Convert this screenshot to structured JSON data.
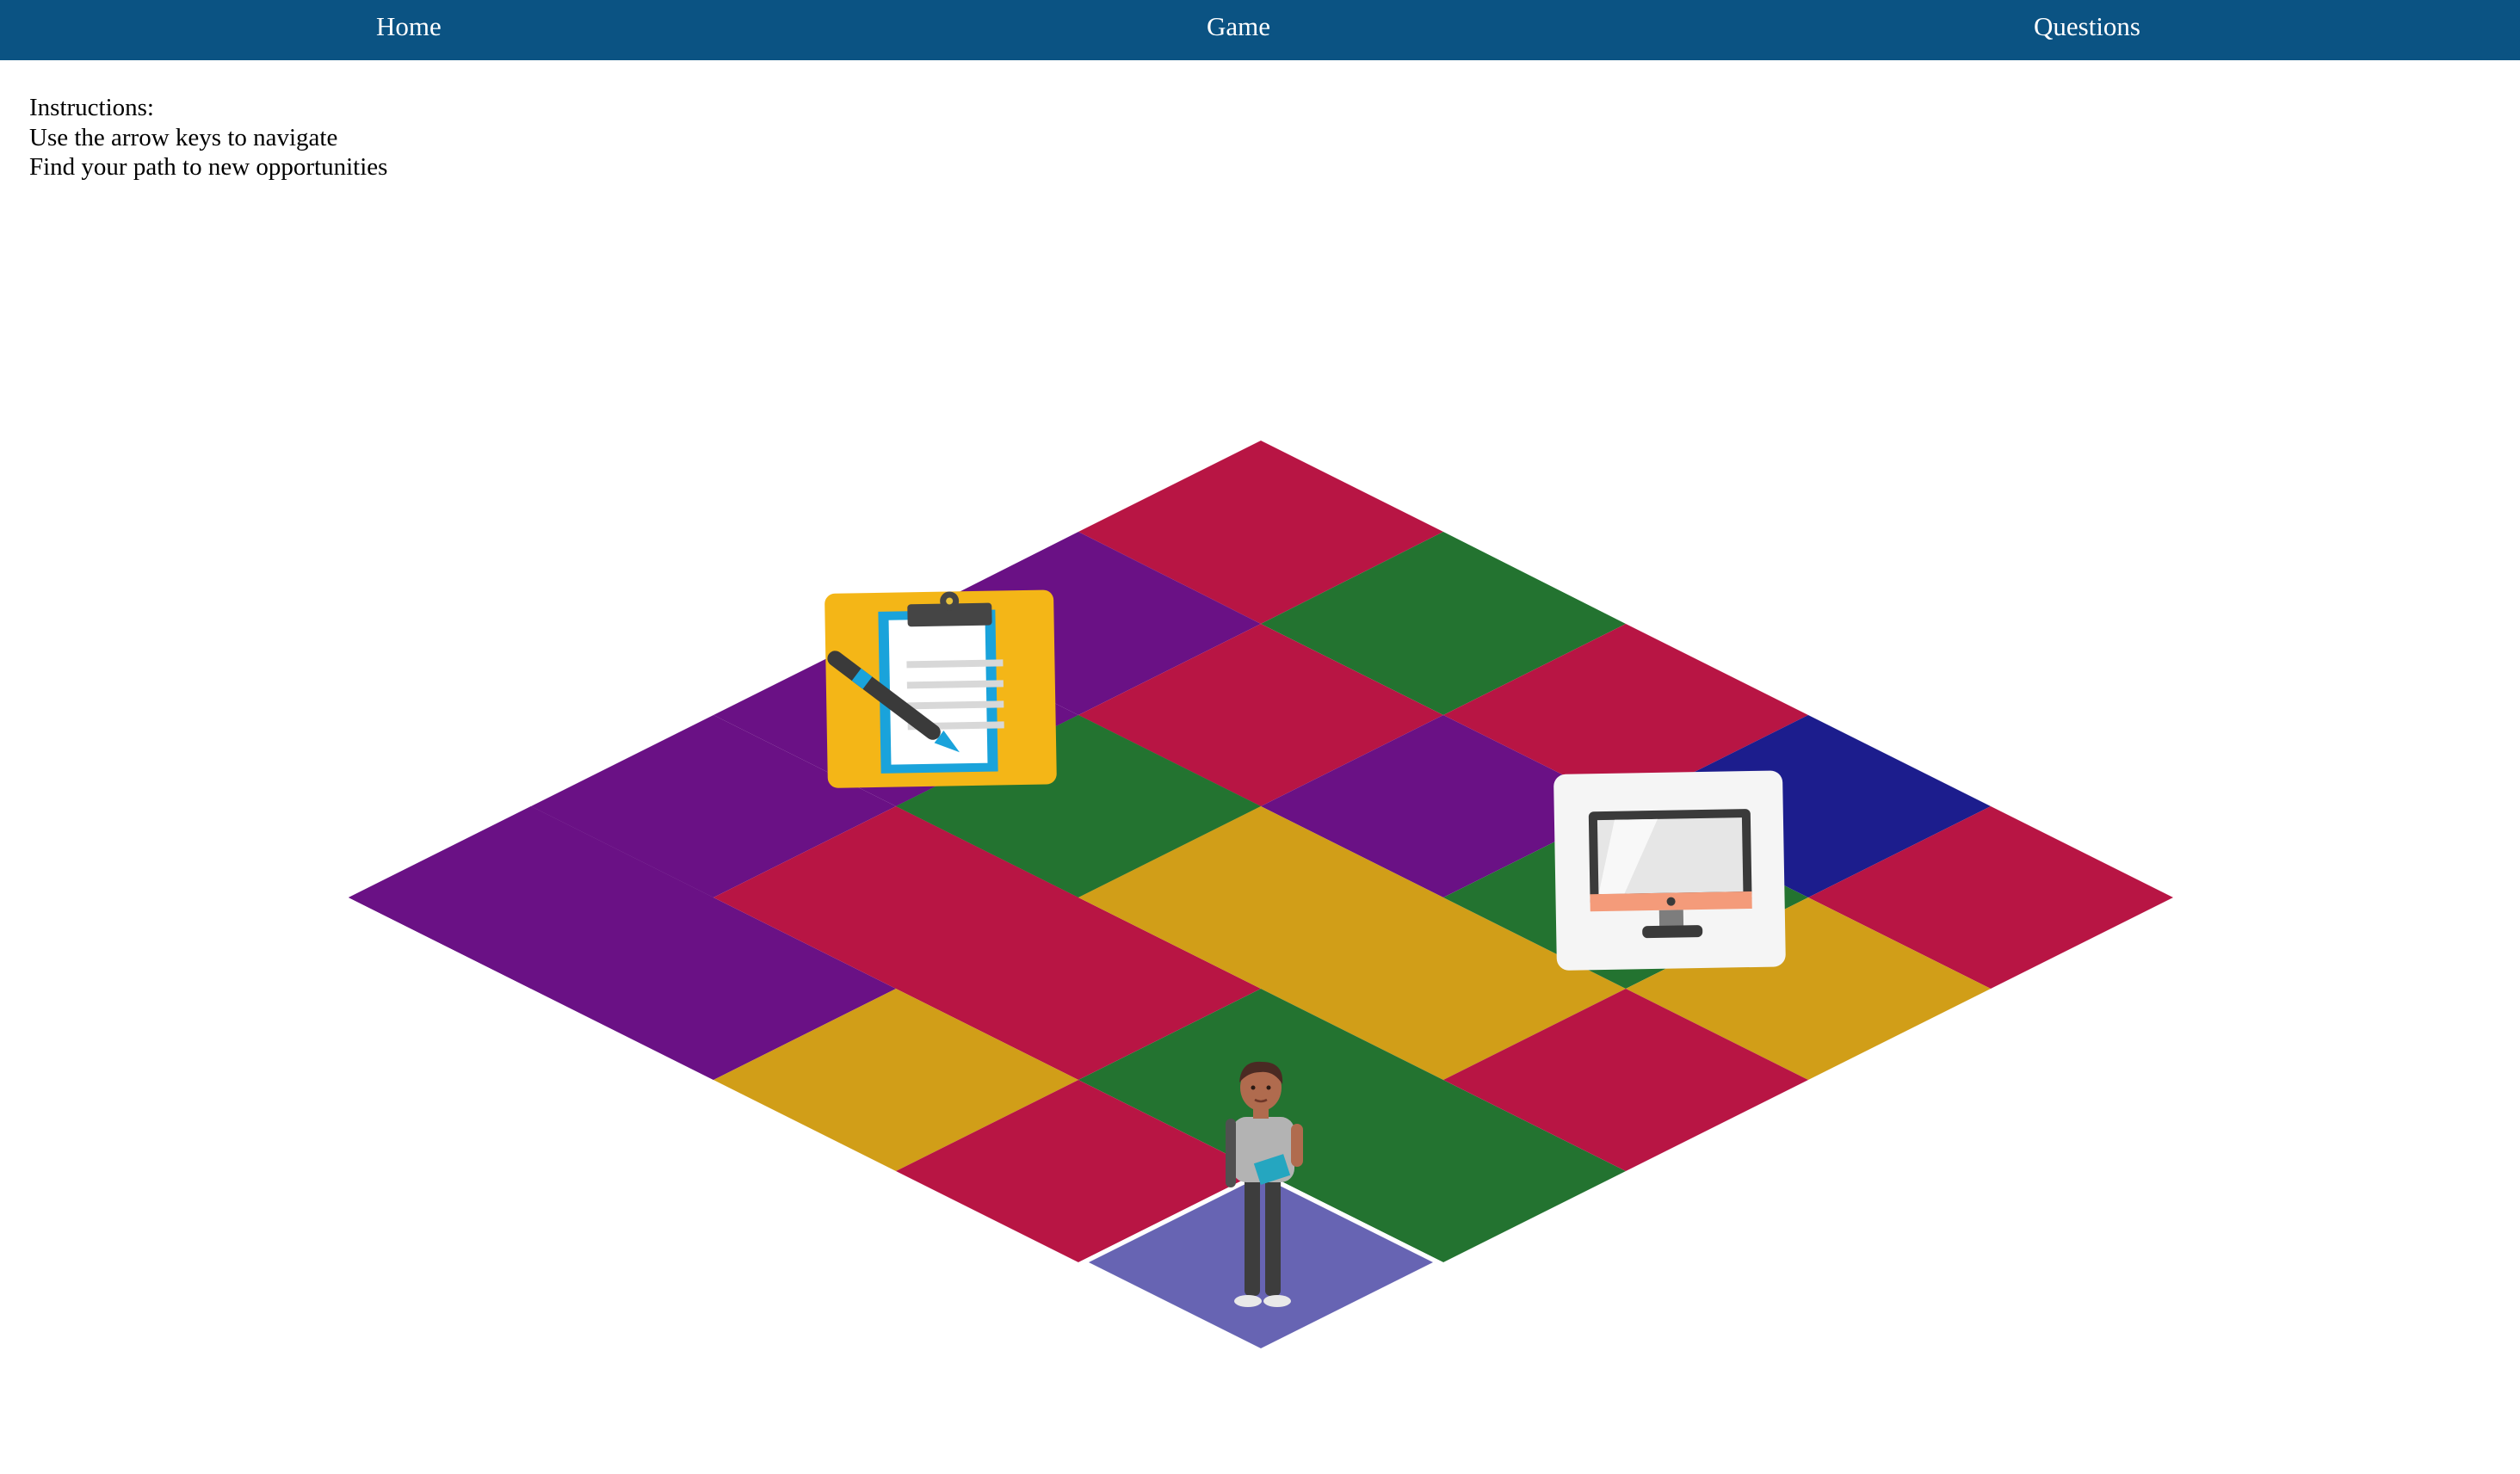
{
  "nav": {
    "home_label": "Home",
    "game_label": "Game",
    "questions_label": "Questions"
  },
  "instructions": {
    "heading": "Instructions:",
    "line1": "Use the arrow keys to navigate",
    "line2": "Find your path to new opportunities"
  },
  "colors": {
    "navbar": "#0b5383",
    "crimson": "#b81544",
    "purple": "#6a1185",
    "green": "#237330",
    "gold": "#d19e18",
    "navy": "#1c1d8d",
    "lavender": "#6764b3"
  },
  "board": {
    "rows": 5,
    "cols": 5,
    "player_tile": "lavender",
    "icons": [
      "clipboard-icon",
      "computer-monitor-icon",
      "student-avatar"
    ]
  }
}
